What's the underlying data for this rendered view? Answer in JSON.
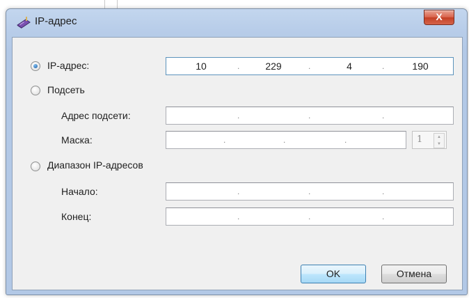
{
  "window": {
    "title": "IP-адрес",
    "close_label": "X"
  },
  "options": {
    "ip": {
      "label": "IP-адрес:",
      "selected": true,
      "value": [
        "10",
        "229",
        "4",
        "190"
      ]
    },
    "subnet": {
      "label": "Подсеть",
      "selected": false,
      "address_label": "Адрес подсети:",
      "mask_label": "Маска:",
      "prefix_value": "1"
    },
    "range": {
      "label": "Диапазон IP-адресов",
      "selected": false,
      "start_label": "Начало:",
      "end_label": "Конец:"
    }
  },
  "buttons": {
    "ok": "OK",
    "cancel": "Отмена"
  },
  "separator": "."
}
